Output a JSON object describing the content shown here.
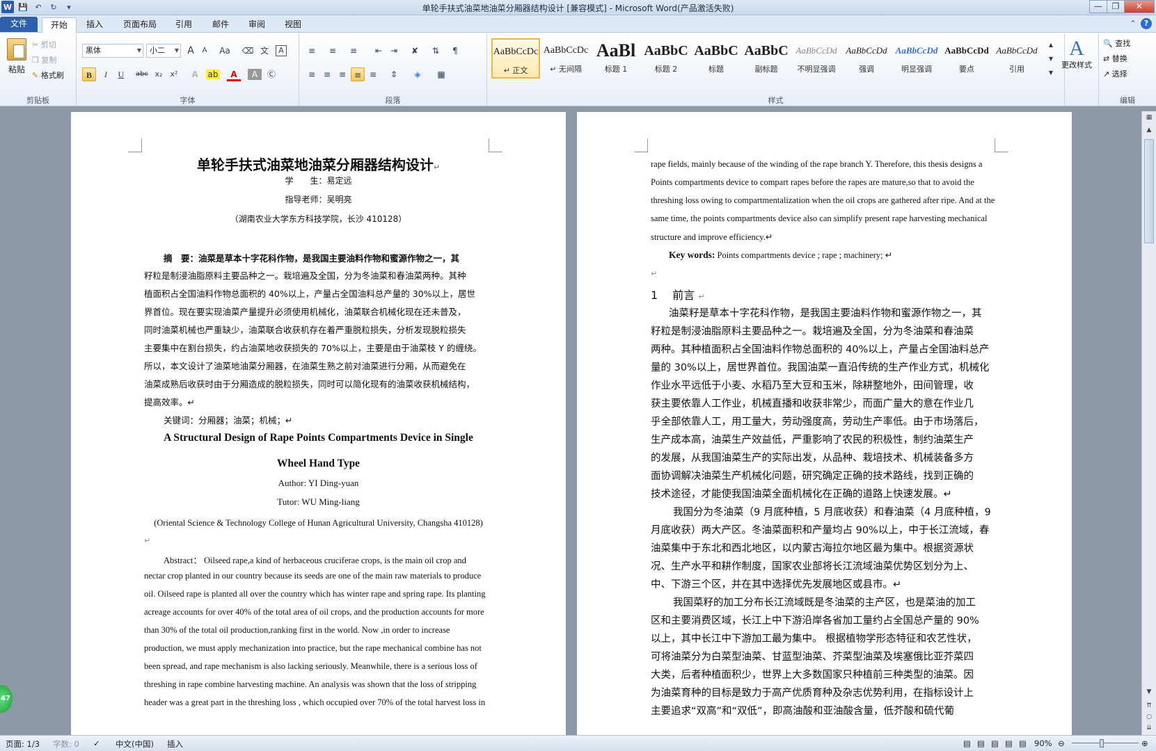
{
  "window": {
    "title": "单轮手扶式油菜地油菜分厢器结构设计 [兼容模式] - Microsoft Word(产品激活失败)",
    "word_logo": "W"
  },
  "ribbon_tabs": [
    "文件",
    "开始",
    "插入",
    "页面布局",
    "引用",
    "邮件",
    "审阅",
    "视图"
  ],
  "clipboard": {
    "paste": "粘贴",
    "cut": "剪切",
    "copy": "复制",
    "format_painter": "格式刷",
    "group": "剪贴板"
  },
  "font": {
    "name": "黑体",
    "size": "小二",
    "group": "字体",
    "grow": "A",
    "shrink": "A",
    "change_case": "Aa",
    "bold": "B",
    "italic": "I",
    "underline": "U",
    "strike": "abc",
    "sub": "x₂",
    "sup": "x²"
  },
  "paragraph": {
    "group": "段落"
  },
  "styles": {
    "group": "样式",
    "items": [
      {
        "preview": "AaBbCcDc",
        "name": "↵ 正文"
      },
      {
        "preview": "AaBbCcDc",
        "name": "↵ 无间隔"
      },
      {
        "preview": "AaBl",
        "name": "标题 1"
      },
      {
        "preview": "AaBbC",
        "name": "标题 2"
      },
      {
        "preview": "AaBbC",
        "name": "标题"
      },
      {
        "preview": "AaBbC",
        "name": "副标题"
      },
      {
        "preview": "AaBbCcDd",
        "name": "不明显强调"
      },
      {
        "preview": "AaBbCcDd",
        "name": "强调"
      },
      {
        "preview": "AaBbCcDd",
        "name": "明显强调"
      },
      {
        "preview": "AaBbCcDd",
        "name": "要点"
      },
      {
        "preview": "AaBbCcDd",
        "name": "引用"
      }
    ],
    "change_styles": "更改样式"
  },
  "editing": {
    "group": "编辑",
    "find": "查找",
    "replace": "替换",
    "select": "选择"
  },
  "page1": {
    "title": "单轮手扶式油菜地油菜分厢器结构设计",
    "student": "学　　生：易定远",
    "tutor": "指导老师：吴明亮",
    "affiliation": "（湖南农业大学东方科技学院，长沙  410128）",
    "abstract_lines": [
      "摘　要：油菜是草本十字花科作物，是我国主要油料作物和蜜源作物之一，其",
      "籽粒是制浸油脂原料主要品种之一。栽培遍及全国，分为冬油菜和春油菜两种。其种",
      "植面积占全国油料作物总面积的 40%以上，产量占全国油料总产量的 30%以上，居世",
      "界首位。现在要实现油菜产量提升必须使用机械化，油菜联合机械化现在还未普及，",
      "同时油菜机械也严重缺少，油菜联合收获机存在着严重脱粒损失，分析发现脱粒损失",
      "主要集中在割台损失，约占油菜地收获损失的 70%以上，主要是由于油菜枝 Y 的缠绕。",
      "所以，本文设计了油菜地油菜分厢器，在油菜生熟之前对油菜进行分厢，从而避免在",
      "油菜成熟后收获时由于分厢造成的脱粒损失，同时可以简化现有的油菜收获机械结构，",
      "提高效率。↵"
    ],
    "keywords": "关键词：分厢器；油菜；机械；↵",
    "en_title_1": "A Structural Design of Rape Points Compartments Device in Single",
    "en_title_2": "Wheel Hand Type",
    "en_author": "Author:    YI Ding-yuan",
    "en_tutor": "Tutor:     WU Ming-liang",
    "en_affiliation": "(Oriental Science  & Technology College of Hunan Agricultural University, Changsha 410128)",
    "en_abstract_lines": [
      "Abstract：  Oilseed rape,a kind of herbaceous cruciferae crops, is the main oil crop and",
      "nectar crop planted in our country because its seeds are one of the main raw materials to produce",
      "oil. Oilseed rape is planted all over the country which has winter rape and spring rape. Its planting",
      "acreage accounts for over 40% of the total area of oil crops, and the production accounts for more",
      "than  30%  of  the  total  oil  production,ranking  first  in  the  world.  Now  ,in  order  to  increase",
      "production, we must apply mechanization into practice, but the rape mechanical combine has not",
      "been spread, and rape mechanism is also lacking seriously. Meanwhile, there is a  serious loss of",
      "threshing in rape combine harvesting machine. An analysis was shown that the loss of stripping",
      "header was a great part in the threshing loss , which occupied over 70% of the total harvest loss in"
    ]
  },
  "page2": {
    "en_lines": [
      "rape fields, mainly because of the winding of the rape branch Y. Therefore, this thesis designs a",
      "Points  compartments  device  to  compart  rapes  before  the  rapes  are  mature,so  that  to    avoid  the",
      "threshing loss owing to compartmentalization when the oil crops are gathered after ripe. And at the",
      "same time, the points compartments device also can simplify present rape harvesting mechanical",
      "structure and improve efficiency.↵"
    ],
    "keywords_label": "Key words:",
    "keywords_value": "Points compartments device ; rape ; machinery;  ↵",
    "section_heading": "1　 前言",
    "body_lines": [
      "油菜籽是草本十字花科作物，是我国主要油料作物和蜜源作物之一，其",
      "籽粒是制浸油脂原料主要品种之一。栽培遍及全国，分为冬油菜和春油菜",
      "两种。其种植面积占全国油料作物总面积的 40%以上，产量占全国油料总产",
      "量的 30%以上，居世界首位。我国油菜一直沿传统的生产作业方式，机械化",
      "作业水平远低于小麦、水稻乃至大豆和玉米，除耕整地外，田间管理，收",
      "获主要依靠人工作业，机械直播和收获非常少，而面广量大的意在作业几",
      "乎全部依靠人工，用工量大，劳动强度高，劳动生产率低。由于市场落后，",
      "生产成本高，油菜生产效益低，严重影响了农民的积极性，制约油菜生产",
      "的发展，从我国油菜生产的实际出发，从品种、栽培技术、机械装备多方",
      "面协调解决油菜生产机械化问题，研究确定正确的技术路线，找到正确的",
      "技术途径，才能使我国油菜全面机械化在正确的道路上快速发展。↵",
      "我国分为冬油菜（9 月底种植，5 月底收获）和春油菜（4 月底种植，9",
      "月底收获）两大产区。冬油菜面积和产量均占 90%以上，中于长江流域，春",
      "油菜集中于东北和西北地区，以内蒙古海拉尔地区最为集中。根据资源状",
      "况、生产水平和耕作制度，国家农业部将长江流域油菜优势区划分为上、",
      "中、下游三个区，并在其中选择优先发展地区或县市。↵",
      "我国菜籽的加工分布长江流域既是冬油菜的主产区，也是菜油的加工",
      "区和主要消费区域，长江上中下游沿岸各省加工量约占全国总产量的 90%",
      "以上，其中长江中下游加工最为集中。  根据植物学形态特征和农艺性状，",
      "可将油菜分为白菜型油菜、甘蓝型油菜、芥菜型油菜及埃塞俄比亚芥菜四",
      "大类，后者种植面积少，世界上大多数国家只种植前三种类型的油菜。因",
      "为油菜育种的目标是致力于高产优质育种及杂志优势利用，在指标设计上",
      "主要追求“双高”和“双低”，即高油酸和亚油酸含量，低芥酸和硫代葡"
    ]
  },
  "status": {
    "page": "页面: 1/3",
    "words": "字数: 0",
    "language": "中文(中国)",
    "mode": "插入",
    "zoom": "90%"
  },
  "badge": "47"
}
